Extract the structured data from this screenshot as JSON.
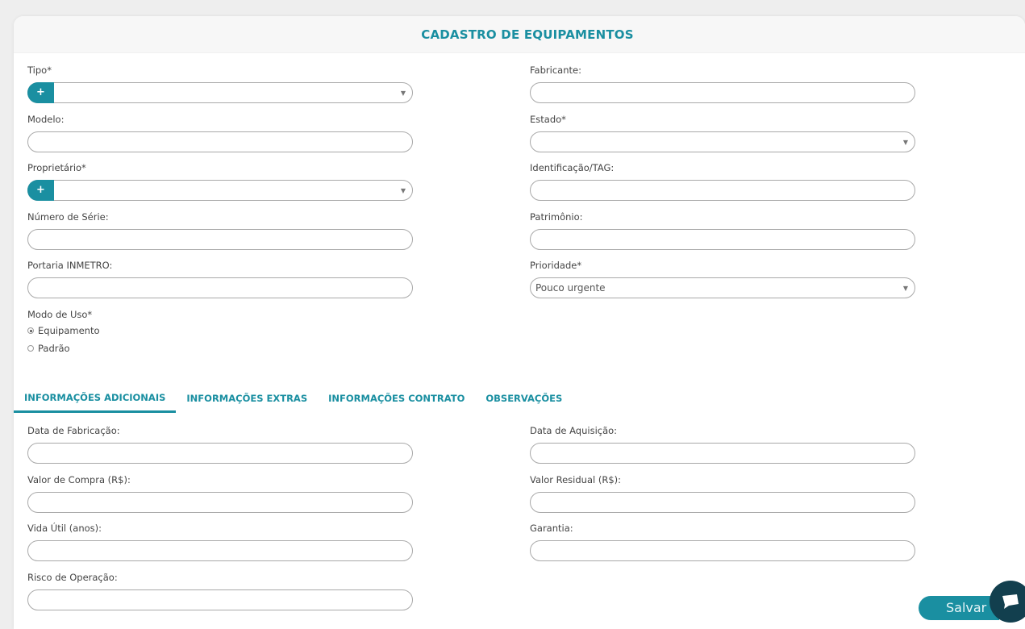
{
  "header": {
    "title": "CADASTRO DE EQUIPAMENTOS"
  },
  "left_fields": [
    {
      "label": "Tipo*",
      "value": ""
    },
    {
      "label": "Modelo:",
      "value": ""
    },
    {
      "label": "Proprietário*",
      "value": ""
    },
    {
      "label": "Número de Série:",
      "value": ""
    },
    {
      "label": "Portaria INMETRO:",
      "value": ""
    }
  ],
  "right_fields": [
    {
      "label": "Fabricante:",
      "value": ""
    },
    {
      "label": "Estado*",
      "value": ""
    },
    {
      "label": "Identificação/TAG:",
      "value": ""
    },
    {
      "label": "Patrimônio:",
      "value": ""
    },
    {
      "label": "Prioridade*",
      "value": "Pouco urgente"
    }
  ],
  "add_button_label": "+",
  "modo_uso": {
    "label": "Modo de Uso*",
    "options": [
      "Equipamento",
      "Padrão"
    ],
    "selected": "Equipamento"
  },
  "tabs": [
    {
      "label": "INFORMAÇÕES ADICIONAIS",
      "active": true
    },
    {
      "label": "INFORMAÇÕES EXTRAS",
      "active": false
    },
    {
      "label": "INFORMAÇÕES CONTRATO",
      "active": false
    },
    {
      "label": "OBSERVAÇÕES",
      "active": false
    }
  ],
  "extra_left": [
    {
      "label": "Data de Fabricação:",
      "value": ""
    },
    {
      "label": "Valor de Compra (R$):",
      "value": ""
    },
    {
      "label": "Vida Útil (anos):",
      "value": ""
    },
    {
      "label": "Risco de Operação:",
      "value": ""
    }
  ],
  "extra_right": [
    {
      "label": "Data de Aquisição:",
      "value": ""
    },
    {
      "label": "Valor Residual (R$):",
      "value": ""
    },
    {
      "label": "Garantia:",
      "value": ""
    }
  ],
  "save_label": "Salvar",
  "icons": {
    "chat": "chat-bubble-icon",
    "dropdown": "chevron-down-icon",
    "add": "plus-icon"
  },
  "colors": {
    "accent": "#1a8fa1",
    "chat": "#123f4e"
  }
}
